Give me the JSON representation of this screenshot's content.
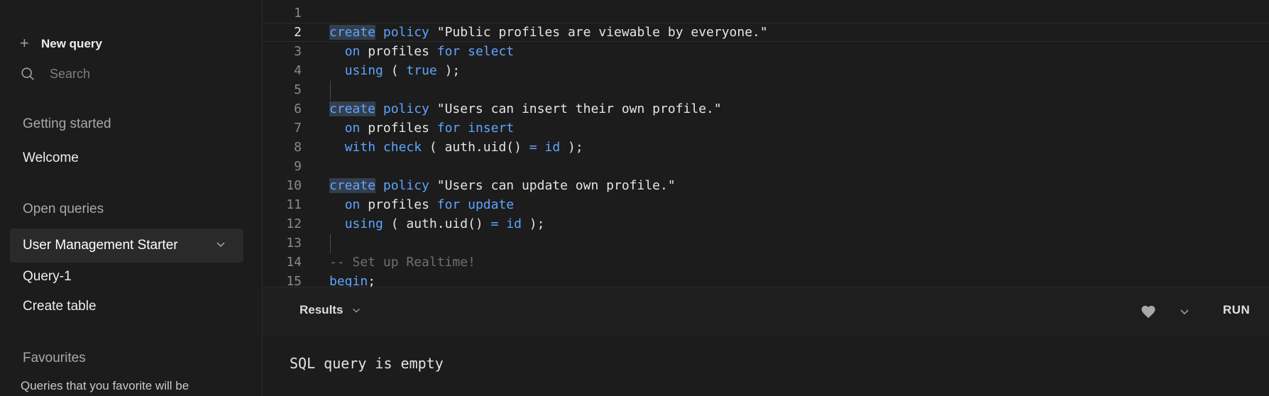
{
  "sidebar": {
    "new_query_label": "New query",
    "search_placeholder": "Search",
    "getting_started_heading": "Getting started",
    "welcome_item": "Welcome",
    "open_queries_heading": "Open queries",
    "open_queries": [
      "User Management Starter",
      "Query-1",
      "Create table"
    ],
    "active_query": "User Management Starter",
    "favourites_heading": "Favourites",
    "favourites_note": "Queries that you favorite will be"
  },
  "editor": {
    "active_line": 2,
    "lines": [
      {
        "n": "1",
        "tokens": []
      },
      {
        "n": "2",
        "tokens": [
          {
            "t": "create",
            "c": "kw hl"
          },
          {
            "t": " "
          },
          {
            "t": "policy",
            "c": "kw"
          },
          {
            "t": " \"Public profiles are viewable by everyone.\""
          }
        ]
      },
      {
        "n": "3",
        "tokens": [
          {
            "t": "  "
          },
          {
            "t": "on",
            "c": "kw"
          },
          {
            "t": " profiles "
          },
          {
            "t": "for",
            "c": "kw"
          },
          {
            "t": " "
          },
          {
            "t": "select",
            "c": "kw"
          }
        ]
      },
      {
        "n": "4",
        "tokens": [
          {
            "t": "  "
          },
          {
            "t": "using",
            "c": "kw"
          },
          {
            "t": " ( "
          },
          {
            "t": "true",
            "c": "kw"
          },
          {
            "t": " );"
          }
        ]
      },
      {
        "n": "5",
        "tokens": []
      },
      {
        "n": "6",
        "tokens": [
          {
            "t": "create",
            "c": "kw hl"
          },
          {
            "t": " "
          },
          {
            "t": "policy",
            "c": "kw"
          },
          {
            "t": " \"Users can insert their own profile.\""
          }
        ]
      },
      {
        "n": "7",
        "tokens": [
          {
            "t": "  "
          },
          {
            "t": "on",
            "c": "kw"
          },
          {
            "t": " profiles "
          },
          {
            "t": "for",
            "c": "kw"
          },
          {
            "t": " "
          },
          {
            "t": "insert",
            "c": "kw"
          }
        ]
      },
      {
        "n": "8",
        "tokens": [
          {
            "t": "  "
          },
          {
            "t": "with",
            "c": "kw"
          },
          {
            "t": " "
          },
          {
            "t": "check",
            "c": "kw"
          },
          {
            "t": " ( auth.uid() "
          },
          {
            "t": "=",
            "c": "kw"
          },
          {
            "t": " "
          },
          {
            "t": "id",
            "c": "kw"
          },
          {
            "t": " );"
          }
        ]
      },
      {
        "n": "9",
        "tokens": []
      },
      {
        "n": "10",
        "tokens": [
          {
            "t": "create",
            "c": "kw hl"
          },
          {
            "t": " "
          },
          {
            "t": "policy",
            "c": "kw"
          },
          {
            "t": " \"Users can update own profile.\""
          }
        ]
      },
      {
        "n": "11",
        "tokens": [
          {
            "t": "  "
          },
          {
            "t": "on",
            "c": "kw"
          },
          {
            "t": " profiles "
          },
          {
            "t": "for",
            "c": "kw"
          },
          {
            "t": " "
          },
          {
            "t": "update",
            "c": "kw"
          }
        ]
      },
      {
        "n": "12",
        "tokens": [
          {
            "t": "  "
          },
          {
            "t": "using",
            "c": "kw"
          },
          {
            "t": " ( auth.uid() "
          },
          {
            "t": "=",
            "c": "kw"
          },
          {
            "t": " "
          },
          {
            "t": "id",
            "c": "kw"
          },
          {
            "t": " );"
          }
        ]
      },
      {
        "n": "13",
        "tokens": []
      },
      {
        "n": "14",
        "tokens": [
          {
            "t": "-- Set up Realtime!",
            "c": "cm"
          }
        ]
      },
      {
        "n": "15",
        "tokens": [
          {
            "t": "begin",
            "c": "kw"
          },
          {
            "t": ";"
          }
        ]
      }
    ]
  },
  "results": {
    "tab_label": "Results",
    "run_label": "RUN",
    "empty_message": "SQL query is empty"
  },
  "colors": {
    "background": "#1c1c1c",
    "keyword": "#5fa4ff",
    "comment": "#6f6f6f",
    "active_item_bg": "#2a2a2a"
  },
  "icons": [
    "plus-icon",
    "search-icon",
    "chevron-down-icon",
    "heart-icon"
  ]
}
